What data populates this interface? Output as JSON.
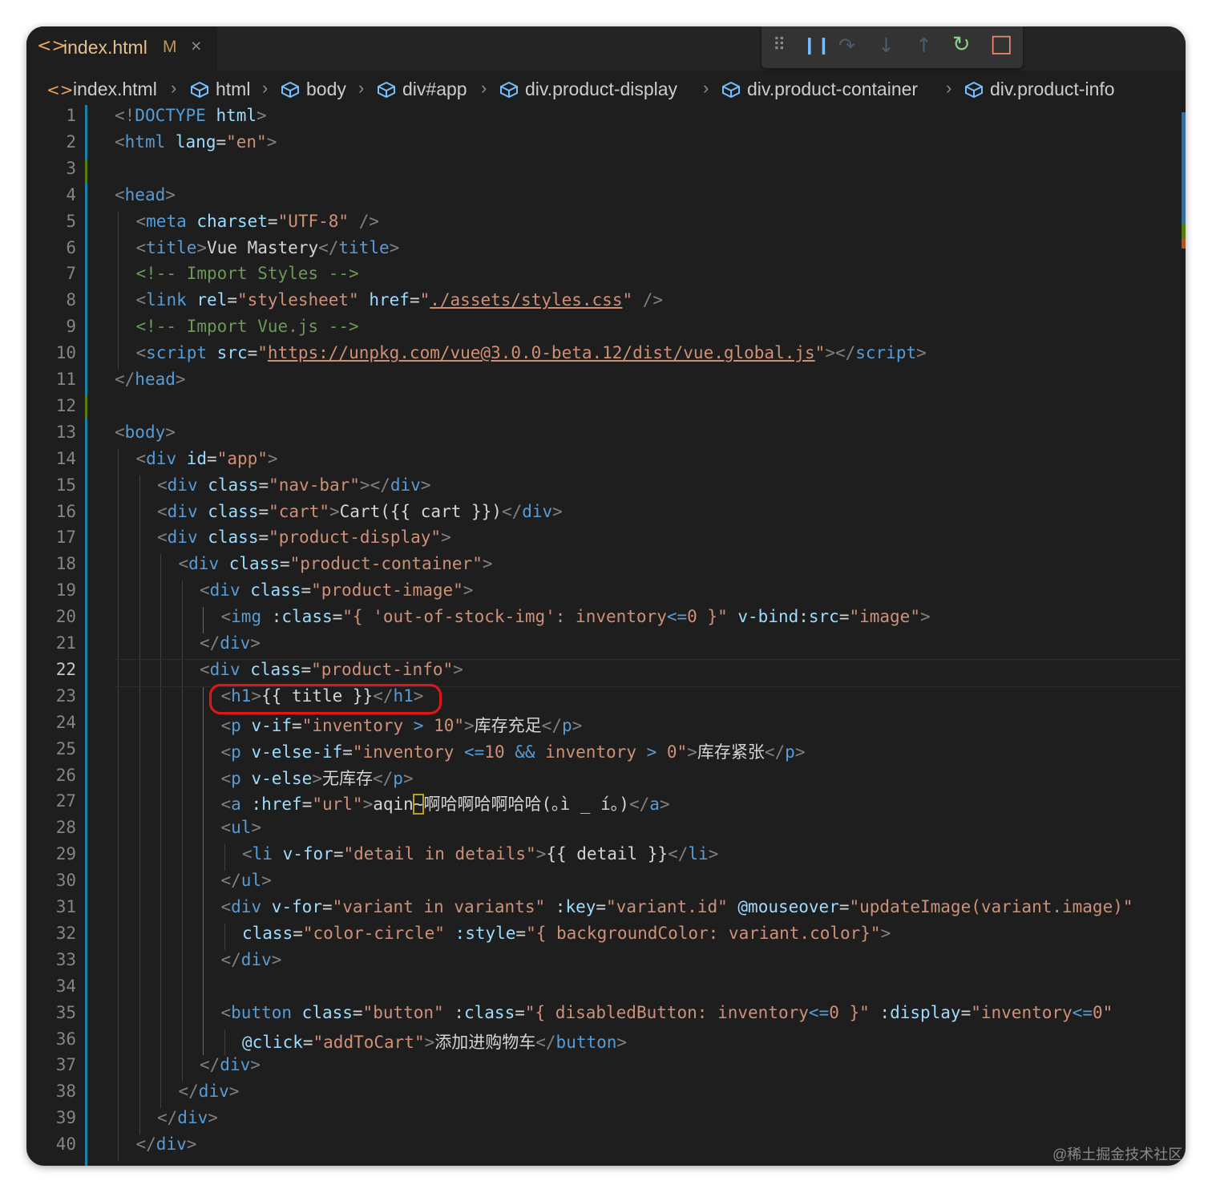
{
  "tab": {
    "file_icon": "<>",
    "name": "index.html",
    "modified": "M",
    "close": "×"
  },
  "debug_toolbar": {
    "grip": "⠿",
    "pause": "❙❙",
    "step_over": "↷",
    "step_into": "↓",
    "step_out": "↑",
    "restart": "↻",
    "stop": "□",
    "icons": [
      "drag-handle-icon",
      "pause-icon",
      "step-over-icon",
      "step-into-icon",
      "step-out-icon",
      "restart-icon",
      "stop-icon"
    ],
    "colors": {
      "pause": "#75beff",
      "restart": "#89d185",
      "stop": "#f48771",
      "disabled": "#4b5b6b"
    }
  },
  "breadcrumb": [
    "index.html",
    "html",
    "body",
    "div#app",
    "div.product-display",
    "div.product-container",
    "div.product-info"
  ],
  "lines": [
    {
      "n": "1",
      "indent": 0,
      "tokens": [
        [
          "b",
          "<!"
        ],
        [
          "t",
          "DOCTYPE"
        ],
        [
          "x",
          " "
        ],
        [
          "a",
          "html"
        ],
        [
          "b",
          ">"
        ]
      ]
    },
    {
      "n": "2",
      "indent": 0,
      "tokens": [
        [
          "b",
          "<"
        ],
        [
          "t",
          "html"
        ],
        [
          "x",
          " "
        ],
        [
          "a",
          "lang"
        ],
        [
          "x",
          "="
        ],
        [
          "s",
          "\"en\""
        ],
        [
          "b",
          ">"
        ]
      ]
    },
    {
      "n": "3",
      "indent": 0,
      "tokens": []
    },
    {
      "n": "4",
      "indent": 0,
      "tokens": [
        [
          "b",
          "<"
        ],
        [
          "t",
          "head"
        ],
        [
          "b",
          ">"
        ]
      ]
    },
    {
      "n": "5",
      "indent": 1,
      "tokens": [
        [
          "b",
          "<"
        ],
        [
          "t",
          "meta"
        ],
        [
          "x",
          " "
        ],
        [
          "a",
          "charset"
        ],
        [
          "x",
          "="
        ],
        [
          "s",
          "\"UTF-8\""
        ],
        [
          "x",
          " "
        ],
        [
          "b",
          "/>"
        ]
      ]
    },
    {
      "n": "6",
      "indent": 1,
      "tokens": [
        [
          "b",
          "<"
        ],
        [
          "t",
          "title"
        ],
        [
          "b",
          ">"
        ],
        [
          "x",
          "Vue Mastery"
        ],
        [
          "b",
          "</"
        ],
        [
          "t",
          "title"
        ],
        [
          "b",
          ">"
        ]
      ]
    },
    {
      "n": "7",
      "indent": 1,
      "tokens": [
        [
          "c",
          "<!-- Import Styles -->"
        ]
      ]
    },
    {
      "n": "8",
      "indent": 1,
      "tokens": [
        [
          "b",
          "<"
        ],
        [
          "t",
          "link"
        ],
        [
          "x",
          " "
        ],
        [
          "a",
          "rel"
        ],
        [
          "x",
          "="
        ],
        [
          "s",
          "\"stylesheet\""
        ],
        [
          "x",
          " "
        ],
        [
          "a",
          "href"
        ],
        [
          "x",
          "="
        ],
        [
          "s",
          "\""
        ],
        [
          "su",
          "./assets/styles.css"
        ],
        [
          "s",
          "\""
        ],
        [
          "x",
          " "
        ],
        [
          "b",
          "/>"
        ]
      ]
    },
    {
      "n": "9",
      "indent": 1,
      "tokens": [
        [
          "c",
          "<!-- Import Vue.js -->"
        ]
      ]
    },
    {
      "n": "10",
      "indent": 1,
      "tokens": [
        [
          "b",
          "<"
        ],
        [
          "t",
          "script"
        ],
        [
          "x",
          " "
        ],
        [
          "a",
          "src"
        ],
        [
          "x",
          "="
        ],
        [
          "s",
          "\""
        ],
        [
          "su",
          "https://unpkg.com/vue@3.0.0-beta.12/dist/vue.global.js"
        ],
        [
          "s",
          "\""
        ],
        [
          "b",
          "></"
        ],
        [
          "t",
          "script"
        ],
        [
          "b",
          ">"
        ]
      ]
    },
    {
      "n": "11",
      "indent": 0,
      "tokens": [
        [
          "b",
          "</"
        ],
        [
          "t",
          "head"
        ],
        [
          "b",
          ">"
        ]
      ]
    },
    {
      "n": "12",
      "indent": 0,
      "tokens": []
    },
    {
      "n": "13",
      "indent": 0,
      "tokens": [
        [
          "b",
          "<"
        ],
        [
          "t",
          "body"
        ],
        [
          "b",
          ">"
        ]
      ]
    },
    {
      "n": "14",
      "indent": 1,
      "tokens": [
        [
          "b",
          "<"
        ],
        [
          "t",
          "div"
        ],
        [
          "x",
          " "
        ],
        [
          "a",
          "id"
        ],
        [
          "x",
          "="
        ],
        [
          "s",
          "\"app\""
        ],
        [
          "b",
          ">"
        ]
      ]
    },
    {
      "n": "15",
      "indent": 2,
      "tokens": [
        [
          "b",
          "<"
        ],
        [
          "t",
          "div"
        ],
        [
          "x",
          " "
        ],
        [
          "a",
          "class"
        ],
        [
          "x",
          "="
        ],
        [
          "s",
          "\"nav-bar\""
        ],
        [
          "b",
          "></"
        ],
        [
          "t",
          "div"
        ],
        [
          "b",
          ">"
        ]
      ]
    },
    {
      "n": "16",
      "indent": 2,
      "tokens": [
        [
          "b",
          "<"
        ],
        [
          "t",
          "div"
        ],
        [
          "x",
          " "
        ],
        [
          "a",
          "class"
        ],
        [
          "x",
          "="
        ],
        [
          "s",
          "\"cart\""
        ],
        [
          "b",
          ">"
        ],
        [
          "x",
          "Cart({{ cart }})"
        ],
        [
          "b",
          "</"
        ],
        [
          "t",
          "div"
        ],
        [
          "b",
          ">"
        ]
      ]
    },
    {
      "n": "17",
      "indent": 2,
      "tokens": [
        [
          "b",
          "<"
        ],
        [
          "t",
          "div"
        ],
        [
          "x",
          " "
        ],
        [
          "a",
          "class"
        ],
        [
          "x",
          "="
        ],
        [
          "s",
          "\"product-display\""
        ],
        [
          "b",
          ">"
        ]
      ]
    },
    {
      "n": "18",
      "indent": 3,
      "tokens": [
        [
          "b",
          "<"
        ],
        [
          "t",
          "div"
        ],
        [
          "x",
          " "
        ],
        [
          "a",
          "class"
        ],
        [
          "x",
          "="
        ],
        [
          "s",
          "\"product-container\""
        ],
        [
          "b",
          ">"
        ]
      ]
    },
    {
      "n": "19",
      "indent": 4,
      "tokens": [
        [
          "b",
          "<"
        ],
        [
          "t",
          "div"
        ],
        [
          "x",
          " "
        ],
        [
          "a",
          "class"
        ],
        [
          "x",
          "="
        ],
        [
          "s",
          "\"product-image\""
        ],
        [
          "b",
          ">"
        ]
      ]
    },
    {
      "n": "20",
      "indent": 5,
      "tokens": [
        [
          "b",
          "<"
        ],
        [
          "t",
          "img"
        ],
        [
          "x",
          " "
        ],
        [
          "a",
          ":class"
        ],
        [
          "x",
          "="
        ],
        [
          "s",
          "\"{ 'out-of-stock-img': inventory"
        ],
        [
          "t",
          "<="
        ],
        [
          "s",
          "0 }\""
        ],
        [
          "x",
          " "
        ],
        [
          "a",
          "v-bind:src"
        ],
        [
          "x",
          "="
        ],
        [
          "s",
          "\"image\""
        ],
        [
          "b",
          ">"
        ]
      ]
    },
    {
      "n": "21",
      "indent": 4,
      "tokens": [
        [
          "b",
          "</"
        ],
        [
          "t",
          "div"
        ],
        [
          "b",
          ">"
        ]
      ]
    },
    {
      "n": "22",
      "indent": 4,
      "active": true,
      "tokens": [
        [
          "b",
          "<"
        ],
        [
          "t",
          "div"
        ],
        [
          "x",
          " "
        ],
        [
          "a",
          "class"
        ],
        [
          "x",
          "="
        ],
        [
          "s",
          "\"product-info\""
        ],
        [
          "b",
          ">"
        ]
      ]
    },
    {
      "n": "23",
      "indent": 5,
      "tokens": [
        [
          "b",
          "<"
        ],
        [
          "t",
          "h1"
        ],
        [
          "b",
          ">"
        ],
        [
          "x",
          "{{ title }}"
        ],
        [
          "b",
          "</"
        ],
        [
          "t",
          "h1"
        ],
        [
          "b",
          ">"
        ]
      ]
    },
    {
      "n": "24",
      "indent": 5,
      "tokens": [
        [
          "b",
          "<"
        ],
        [
          "t",
          "p"
        ],
        [
          "x",
          " "
        ],
        [
          "a",
          "v-if"
        ],
        [
          "x",
          "="
        ],
        [
          "s",
          "\"inventory "
        ],
        [
          "t",
          ">"
        ],
        [
          "s",
          " 10\""
        ],
        [
          "b",
          ">"
        ],
        [
          "x",
          "库存充足"
        ],
        [
          "b",
          "</"
        ],
        [
          "t",
          "p"
        ],
        [
          "b",
          ">"
        ]
      ]
    },
    {
      "n": "25",
      "indent": 5,
      "tokens": [
        [
          "b",
          "<"
        ],
        [
          "t",
          "p"
        ],
        [
          "x",
          " "
        ],
        [
          "a",
          "v-else-if"
        ],
        [
          "x",
          "="
        ],
        [
          "s",
          "\"inventory "
        ],
        [
          "t",
          "<="
        ],
        [
          "s",
          "10 "
        ],
        [
          "t",
          "&&"
        ],
        [
          "s",
          " inventory "
        ],
        [
          "t",
          ">"
        ],
        [
          "s",
          " 0\""
        ],
        [
          "b",
          ">"
        ],
        [
          "x",
          "库存紧张"
        ],
        [
          "b",
          "</"
        ],
        [
          "t",
          "p"
        ],
        [
          "b",
          ">"
        ]
      ]
    },
    {
      "n": "26",
      "indent": 5,
      "tokens": [
        [
          "b",
          "<"
        ],
        [
          "t",
          "p"
        ],
        [
          "x",
          " "
        ],
        [
          "a",
          "v-else"
        ],
        [
          "b",
          ">"
        ],
        [
          "x",
          "无库存"
        ],
        [
          "b",
          "</"
        ],
        [
          "t",
          "p"
        ],
        [
          "b",
          ">"
        ]
      ]
    },
    {
      "n": "27",
      "indent": 5,
      "tokens": [
        [
          "b",
          "<"
        ],
        [
          "t",
          "a"
        ],
        [
          "x",
          " "
        ],
        [
          "a",
          ":href"
        ],
        [
          "x",
          "="
        ],
        [
          "s",
          "\"url\""
        ],
        [
          "b",
          ">"
        ],
        [
          "x",
          "aqin"
        ],
        [
          "xc",
          "~"
        ],
        [
          "x",
          "啊哈啊哈啊哈哈(｡ì _ í｡)"
        ],
        [
          "b",
          "</"
        ],
        [
          "t",
          "a"
        ],
        [
          "b",
          ">"
        ]
      ]
    },
    {
      "n": "28",
      "indent": 5,
      "tokens": [
        [
          "b",
          "<"
        ],
        [
          "t",
          "ul"
        ],
        [
          "b",
          ">"
        ]
      ]
    },
    {
      "n": "29",
      "indent": 6,
      "tokens": [
        [
          "b",
          "<"
        ],
        [
          "t",
          "li"
        ],
        [
          "x",
          " "
        ],
        [
          "a",
          "v-for"
        ],
        [
          "x",
          "="
        ],
        [
          "s",
          "\"detail in details\""
        ],
        [
          "b",
          ">"
        ],
        [
          "x",
          "{{ detail }}"
        ],
        [
          "b",
          "</"
        ],
        [
          "t",
          "li"
        ],
        [
          "b",
          ">"
        ]
      ]
    },
    {
      "n": "30",
      "indent": 5,
      "tokens": [
        [
          "b",
          "</"
        ],
        [
          "t",
          "ul"
        ],
        [
          "b",
          ">"
        ]
      ]
    },
    {
      "n": "31",
      "indent": 5,
      "tokens": [
        [
          "b",
          "<"
        ],
        [
          "t",
          "div"
        ],
        [
          "x",
          " "
        ],
        [
          "a",
          "v-for"
        ],
        [
          "x",
          "="
        ],
        [
          "s",
          "\"variant in variants\""
        ],
        [
          "x",
          " "
        ],
        [
          "a",
          ":key"
        ],
        [
          "x",
          "="
        ],
        [
          "s",
          "\"variant.id\""
        ],
        [
          "x",
          " "
        ],
        [
          "a",
          "@mouseover"
        ],
        [
          "x",
          "="
        ],
        [
          "s",
          "\"updateImage(variant.image)\""
        ]
      ]
    },
    {
      "n": "32",
      "indent": 6,
      "tokens": [
        [
          "a",
          "class"
        ],
        [
          "x",
          "="
        ],
        [
          "s",
          "\"color-circle\""
        ],
        [
          "x",
          " "
        ],
        [
          "a",
          ":style"
        ],
        [
          "x",
          "="
        ],
        [
          "s",
          "\"{ backgroundColor: variant.color}\""
        ],
        [
          "b",
          ">"
        ]
      ]
    },
    {
      "n": "33",
      "indent": 5,
      "tokens": [
        [
          "b",
          "</"
        ],
        [
          "t",
          "div"
        ],
        [
          "b",
          ">"
        ]
      ]
    },
    {
      "n": "34",
      "indent": 5,
      "tokens": []
    },
    {
      "n": "35",
      "indent": 5,
      "tokens": [
        [
          "b",
          "<"
        ],
        [
          "t",
          "button"
        ],
        [
          "x",
          " "
        ],
        [
          "a",
          "class"
        ],
        [
          "x",
          "="
        ],
        [
          "s",
          "\"button\""
        ],
        [
          "x",
          " "
        ],
        [
          "a",
          ":class"
        ],
        [
          "x",
          "="
        ],
        [
          "s",
          "\"{ disabledButton: inventory"
        ],
        [
          "t",
          "<="
        ],
        [
          "s",
          "0 }\""
        ],
        [
          "x",
          " "
        ],
        [
          "a",
          ":display"
        ],
        [
          "x",
          "="
        ],
        [
          "s",
          "\"inventory"
        ],
        [
          "t",
          "<="
        ],
        [
          "s",
          "0\""
        ]
      ]
    },
    {
      "n": "36",
      "indent": 6,
      "tokens": [
        [
          "a",
          "@click"
        ],
        [
          "x",
          "="
        ],
        [
          "s",
          "\"addToCart\""
        ],
        [
          "b",
          ">"
        ],
        [
          "x",
          "添加进购物车"
        ],
        [
          "b",
          "</"
        ],
        [
          "t",
          "button"
        ],
        [
          "b",
          ">"
        ]
      ]
    },
    {
      "n": "37",
      "indent": 4,
      "tokens": [
        [
          "b",
          "</"
        ],
        [
          "t",
          "div"
        ],
        [
          "b",
          ">"
        ]
      ]
    },
    {
      "n": "38",
      "indent": 3,
      "tokens": [
        [
          "b",
          "</"
        ],
        [
          "t",
          "div"
        ],
        [
          "b",
          ">"
        ]
      ]
    },
    {
      "n": "39",
      "indent": 2,
      "tokens": [
        [
          "b",
          "</"
        ],
        [
          "t",
          "div"
        ],
        [
          "b",
          ">"
        ]
      ]
    },
    {
      "n": "40",
      "indent": 1,
      "tokens": [
        [
          "b",
          "</"
        ],
        [
          "t",
          "div"
        ],
        [
          "b",
          ">"
        ]
      ]
    }
  ],
  "watermark": "@稀土掘金技术社区",
  "colors": {
    "background": "#1e1e1e",
    "tag": "#569cd6",
    "attribute": "#9cdcfe",
    "string": "#ce9178",
    "comment": "#6a9955",
    "text": "#d4d4d4",
    "bracket": "#808080",
    "highlight_box": "#e0161b",
    "gutter_added": "#587c0c",
    "gutter_modified": "#1b81a8"
  }
}
